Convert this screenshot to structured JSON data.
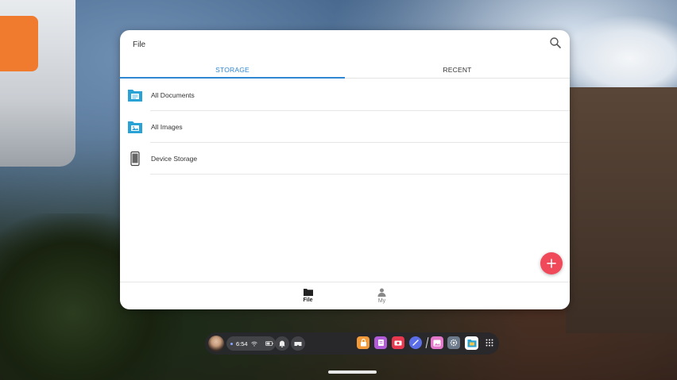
{
  "app": {
    "title": "File"
  },
  "tabs": [
    {
      "label": "STORAGE",
      "active": true
    },
    {
      "label": "RECENT",
      "active": false
    }
  ],
  "list": [
    {
      "label": "All Documents",
      "icon": "documents-folder-icon"
    },
    {
      "label": "All Images",
      "icon": "images-folder-icon"
    },
    {
      "label": "Device Storage",
      "icon": "phone-icon"
    }
  ],
  "fab": {
    "icon": "plus-icon",
    "color": "#f0495a"
  },
  "bottom_nav": [
    {
      "label": "File",
      "icon": "folder-icon",
      "active": true
    },
    {
      "label": "My",
      "icon": "person-icon",
      "active": false
    }
  ],
  "taskbar": {
    "time": "6:54",
    "status_icons": [
      "wifi-icon",
      "battery-icon"
    ],
    "quick_icons": [
      "notification-bell-icon",
      "vr-headset-icon"
    ],
    "apps": [
      "lock-app-icon",
      "notes-app-icon",
      "camera-app-icon",
      "browser-app-icon",
      "gallery-app-icon",
      "settings-app-icon",
      "file-manager-app-icon",
      "app-grid-icon"
    ]
  },
  "colors": {
    "accent": "#2f86d1",
    "fab": "#f0495a",
    "folder": "#29a3d6"
  }
}
